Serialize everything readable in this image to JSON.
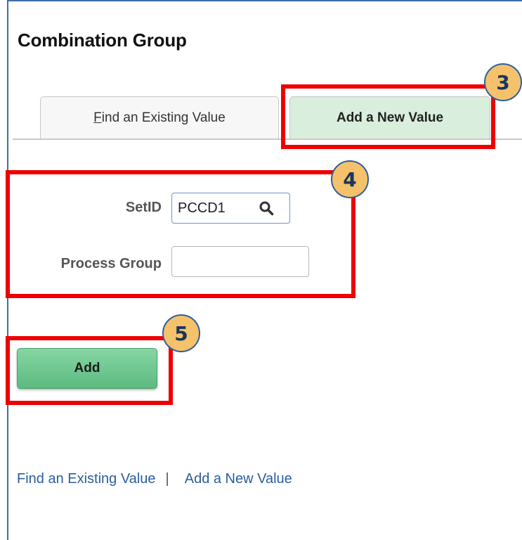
{
  "page": {
    "title": "Combination Group"
  },
  "tabs": {
    "find_prefix": "F",
    "find_rest": "ind an Existing Value",
    "add": "Add a New Value"
  },
  "form": {
    "setid_label": "SetID",
    "setid_value": "PCCD1",
    "process_group_label": "Process Group",
    "process_group_value": ""
  },
  "actions": {
    "add_label": "Add"
  },
  "links": {
    "find": "Find an Existing Value",
    "separator": "|",
    "add": "Add a New Value"
  },
  "annotations": {
    "step3": "3",
    "step4": "4",
    "step5": "5"
  },
  "colors": {
    "highlight": "#ee0000",
    "badge_fill": "#f5c26b",
    "active_tab": "#d9eedc",
    "button_green": "#5cba80",
    "link": "#2a5e9c"
  },
  "icons": {
    "lookup": "search-icon"
  }
}
